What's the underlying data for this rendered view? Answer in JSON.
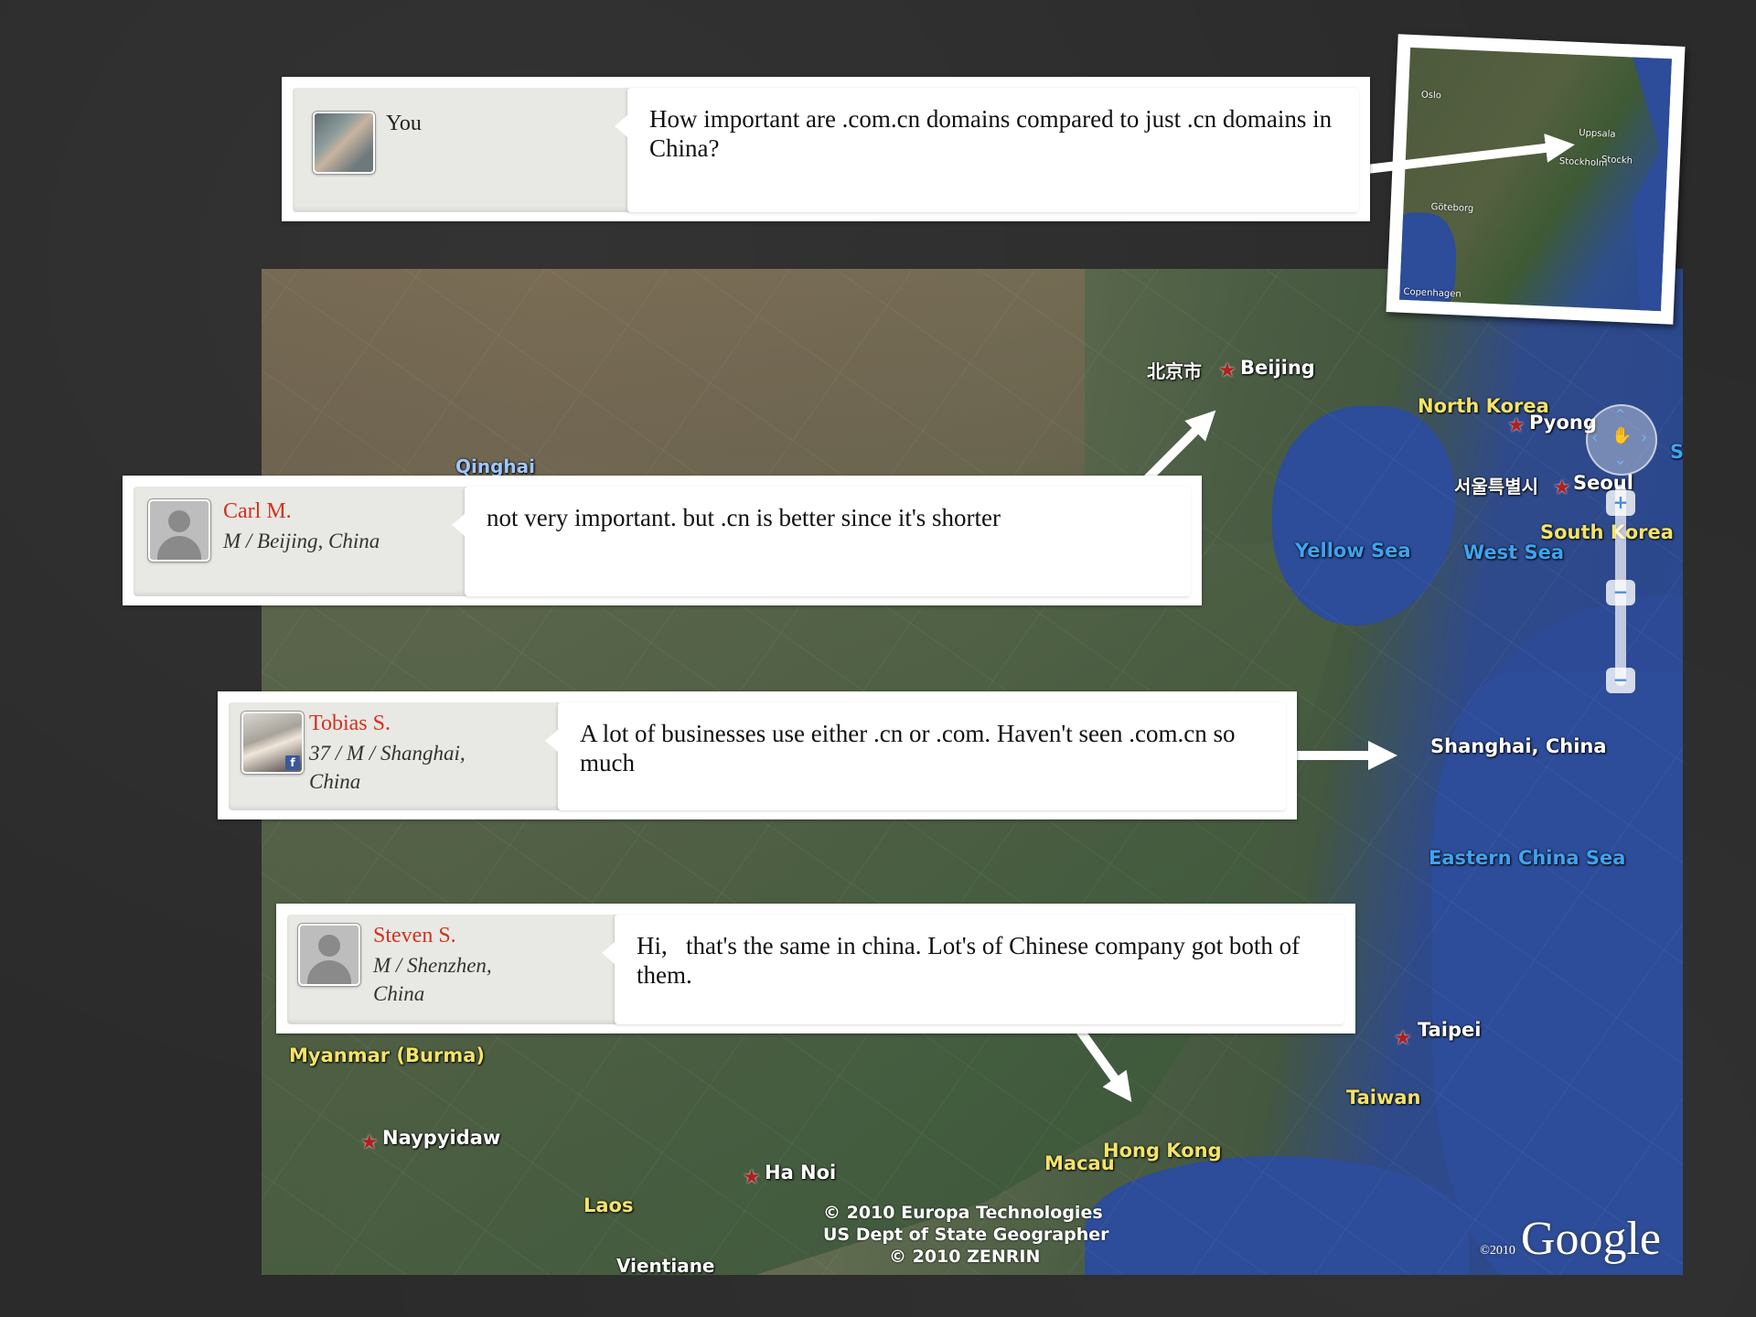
{
  "map": {
    "labels": {
      "beijing_cn": "北京市",
      "beijing": "Beijing",
      "qinghai": "Qinghai",
      "north_korea": "North Korea",
      "pyong": "Pyong",
      "seoul_kr": "서울특별시",
      "seoul": "Seoul",
      "south_korea": "South Korea",
      "yellow_sea": "Yellow Sea",
      "west_sea": "West Sea",
      "sea_partial": "Se",
      "shanghai": "Shanghai, China",
      "eastern_china_sea": "Eastern China Sea",
      "taipei": "Taipei",
      "taiwan": "Taiwan",
      "myanmar": "Myanmar (Burma)",
      "naypyidaw": "Naypyidaw",
      "ha_noi": "Ha Noi",
      "laos": "Laos",
      "macau": "Macau",
      "hong_kong": "Hong Kong",
      "vientiane": "Vientiane"
    },
    "copyright": {
      "line1": "© 2010 Europa Technologies",
      "line2": "US Dept of State Geographer",
      "line3": "© 2010 ZENRIN"
    },
    "google_year": "©2010",
    "google_logo": "Google",
    "zoom_in": "+",
    "zoom_out": "−",
    "colors": {
      "star": "#b0201f",
      "yellow_label": "#f2e36a",
      "blue_label": "#3fa3f0",
      "sea": "#2d4c99"
    }
  },
  "inset": {
    "labels": {
      "oslo": "Oslo",
      "uppsala": "Uppsala",
      "stockholm": "Stockholm",
      "stockh": "Stockh",
      "goteborg": "Göteborg",
      "copenhagen": "Copenhagen"
    }
  },
  "messages": [
    {
      "name": "You",
      "meta": [],
      "text": "How important are .com.cn domains compared to just .cn domains in China?",
      "avatar": "photo"
    },
    {
      "name": "Carl M.",
      "meta": [
        "M / Beijing, China"
      ],
      "text": "not very important. but .cn is better since it's shorter",
      "avatar": "generic"
    },
    {
      "name": "Tobias S.",
      "meta": [
        "37 / M / Shanghai,",
        "China"
      ],
      "text": "A lot of businesses use either .cn or .com. Haven't seen .com.cn so much",
      "avatar": "photo2",
      "badge": "f"
    },
    {
      "name": "Steven S.",
      "meta": [
        "M / Shenzhen,",
        "China"
      ],
      "text": "Hi,   that's the same in china. Lot's of Chinese company got both of them.",
      "avatar": "generic"
    }
  ],
  "colors": {
    "name_accent": "#d2321f",
    "arrow": "#ffffff"
  }
}
